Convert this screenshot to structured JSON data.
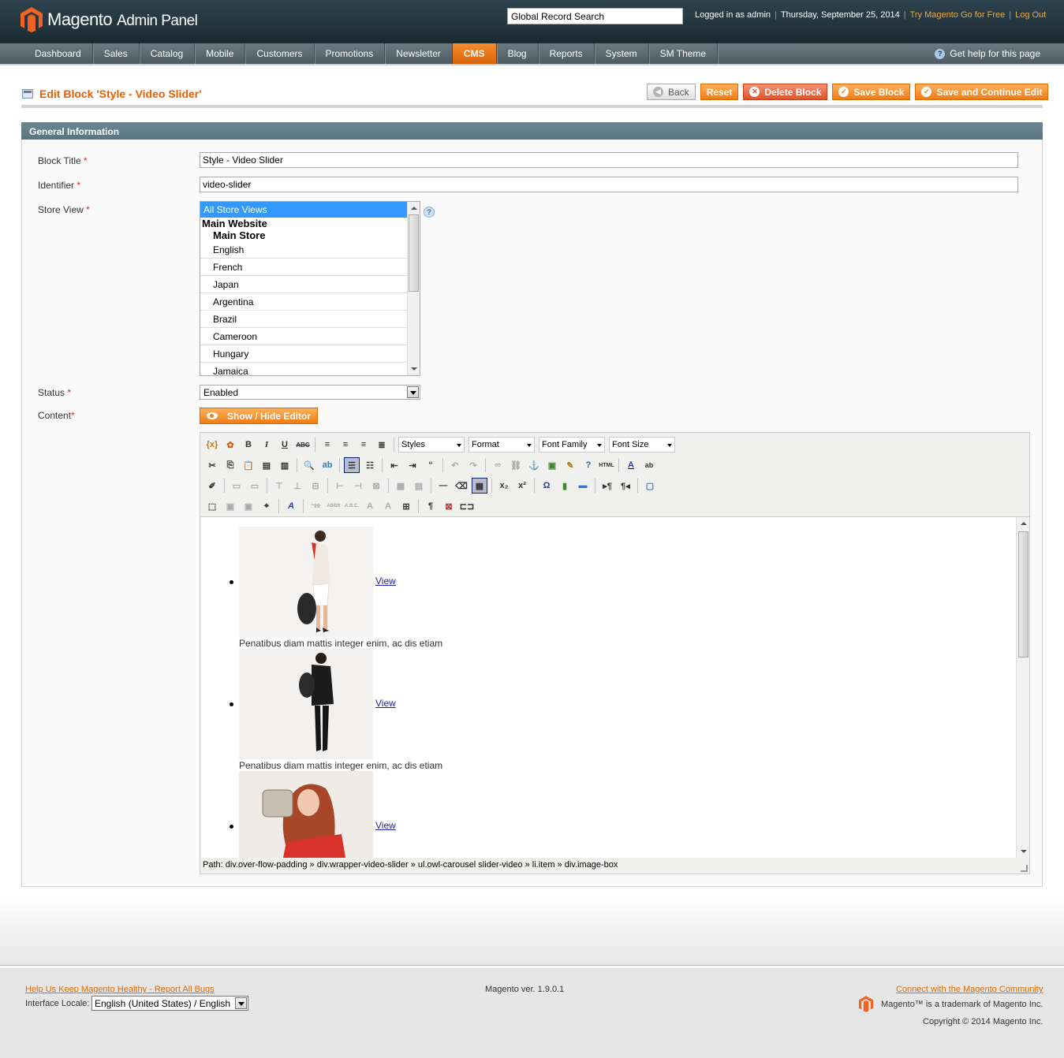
{
  "header": {
    "logo_main": "Magento",
    "logo_sub": "Admin Panel",
    "search_value": "Global Record Search",
    "logged_in": "Logged in as admin",
    "date": "Thursday, September 25, 2014",
    "try_link": "Try Magento Go for Free",
    "logout": "Log Out"
  },
  "nav": {
    "items": [
      "Dashboard",
      "Sales",
      "Catalog",
      "Mobile",
      "Customers",
      "Promotions",
      "Newsletter",
      "CMS",
      "Blog",
      "Reports",
      "System",
      "SM Theme"
    ],
    "active": "CMS",
    "help": "Get help for this page"
  },
  "page": {
    "title": "Edit Block 'Style - Video Slider'",
    "buttons": {
      "back": "Back",
      "reset": "Reset",
      "delete": "Delete Block",
      "save": "Save Block",
      "save_continue": "Save and Continue Edit"
    }
  },
  "form": {
    "section": "General Information",
    "block_title_label": "Block Title",
    "block_title_value": "Style - Video Slider",
    "identifier_label": "Identifier",
    "identifier_value": "video-slider",
    "store_view_label": "Store View",
    "store_views": {
      "selected": "All Store Views",
      "website": "Main Website",
      "store": "Main Store",
      "views": [
        "English",
        "French",
        "Japan",
        "Argentina",
        "Brazil",
        "Cameroon",
        "Hungary",
        "Jamaica"
      ]
    },
    "status_label": "Status",
    "status_value": "Enabled",
    "content_label": "Content",
    "show_hide": "Show / Hide Editor",
    "required_mark": "*"
  },
  "editor": {
    "selects": [
      "Styles",
      "Format",
      "Font Family",
      "Font Size"
    ],
    "items": [
      {
        "link": "View",
        "caption": "Penatibus diam mattis integer enim, ac dis etiam"
      },
      {
        "link": "View",
        "caption": "Penatibus diam mattis integer enim, ac dis etiam"
      },
      {
        "link": "View",
        "caption": ""
      }
    ],
    "path": "Path: div.over-flow-padding » div.wrapper-video-slider » ul.owl-carousel slider-video » li.item » div.image-box"
  },
  "footer": {
    "bugs_link": "Help Us Keep Magento Healthy - Report All Bugs",
    "version": "Magento ver. 1.9.0.1",
    "community_link": "Connect with the Magento Community",
    "locale_label": "Interface Locale:",
    "locale_value": "English (United States) / English",
    "trademark": "Magento™ is a trademark of Magento Inc.",
    "copyright": "Copyright © 2014 Magento Inc."
  },
  "colors": {
    "accent": "#eb5e00",
    "header_bg": "#24363f",
    "nav_bg": "#5d6b71",
    "section_bg": "#607e8a"
  }
}
